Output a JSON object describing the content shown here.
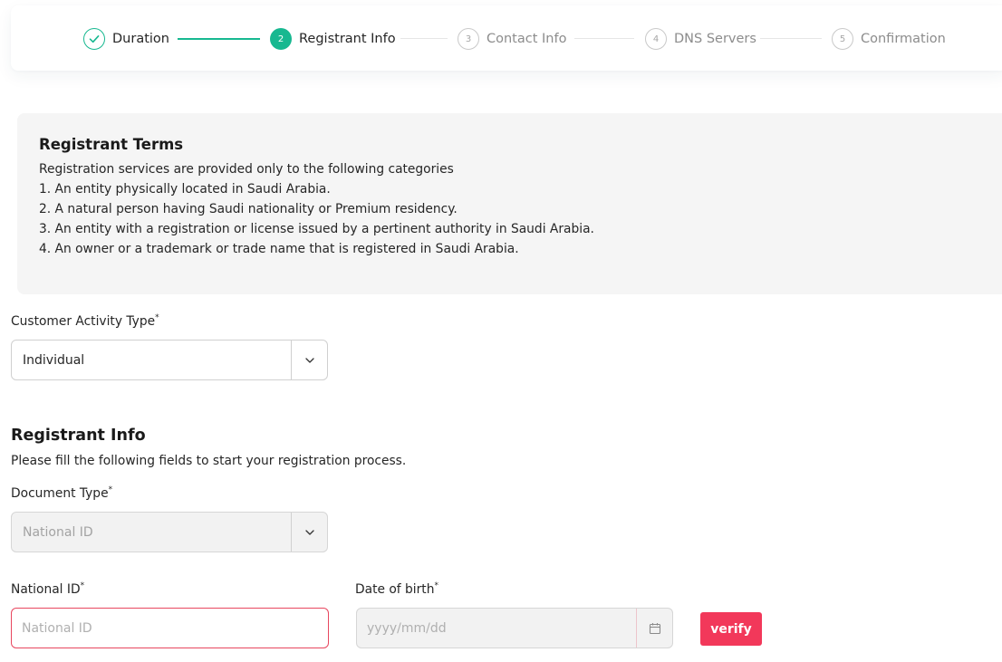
{
  "stepper": {
    "steps": [
      {
        "number": "1",
        "label": "Duration",
        "state": "done",
        "icon": "check-icon"
      },
      {
        "number": "2",
        "label": "Registrant Info",
        "state": "active"
      },
      {
        "number": "3",
        "label": "Contact Info",
        "state": "pending"
      },
      {
        "number": "4",
        "label": "DNS Servers",
        "state": "pending"
      },
      {
        "number": "5",
        "label": "Confirmation",
        "state": "pending"
      }
    ]
  },
  "terms": {
    "title": "Registrant Terms",
    "intro": "Registration services are provided only to the following categories",
    "items": [
      " 1. An entity physically located in Saudi Arabia.",
      "2. A natural person having Saudi nationality or Premium residency.",
      "3. An entity with a registration or license issued by a pertinent authority in Saudi Arabia.",
      "4. An owner or a trademark or trade name that is registered in Saudi Arabia."
    ]
  },
  "customer_activity": {
    "label": "Customer Activity Type",
    "required_mark": "*",
    "value": "Individual",
    "icon": "chevron-down-icon"
  },
  "registrant_info": {
    "title": "Registrant Info",
    "subtitle": "Please fill the following fields to start your registration process.",
    "document_type": {
      "label": "Document Type",
      "required_mark": "*",
      "value": "National ID",
      "disabled": true
    },
    "national_id": {
      "label": "National ID",
      "required_mark": "*",
      "placeholder": "National ID",
      "value": ""
    },
    "date_of_birth": {
      "label": "Date of birth",
      "required_mark": "*",
      "placeholder": "yyyy/mm/dd",
      "icon": "calendar-icon"
    },
    "verify_label": "verify"
  },
  "colors": {
    "accent": "#17b890",
    "danger": "#f2385a",
    "error_border": "#e8475f",
    "terms_bg": "#f5f5f5"
  }
}
